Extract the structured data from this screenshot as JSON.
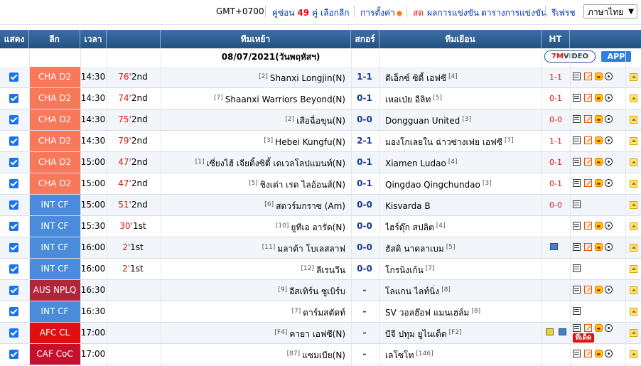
{
  "topbar": {
    "timezone": "GMT+0700",
    "pairs_prefix": "คู่ซ่อน",
    "pairs_count": "49",
    "pairs_suffix": "คู่",
    "select_league": "เลือกลีก",
    "settings": "การตั้งค่า",
    "live": "สด",
    "results": "ผลการแข่งขัน",
    "fixtures": "ตารางการแข่งขัน",
    "refresh": "รีเฟรช",
    "language": "ภาษาไทย"
  },
  "columns": {
    "show": "แสดง",
    "league": "ลีก",
    "time": "เวลา",
    "home": "ทีมเหย้า",
    "score": "สกอร์",
    "away": "ทีมเยือน",
    "ht": "HT"
  },
  "date_label": "08/07/2021(วันพฤหัสฯ)",
  "buttons": {
    "video_7": "7M",
    "video_text": "VIDEO",
    "app": "APP"
  },
  "colors": {
    "cha": "#f8785a",
    "int": "#4a8cdb",
    "aus": "#b0263a",
    "afc": "#e01010",
    "caf": "#c8102e"
  },
  "matches": [
    {
      "league": "CHA D2",
      "color": "#f8785a",
      "time": "14:30",
      "minute": "76'",
      "half": "2nd",
      "home_rank": "[2]",
      "home": "Shanxi Longjin(N)",
      "score": "1-1",
      "away": "ดีเอ็กซ์ ซิตี้ เอฟซี",
      "away_rank": "[4]",
      "ht": "1-1",
      "icons": [
        "note",
        "edit",
        "face",
        "ball"
      ]
    },
    {
      "league": "CHA D2",
      "color": "#f8785a",
      "time": "14:30",
      "minute": "74'",
      "half": "2nd",
      "home_rank": "[7]",
      "home": "Shaanxi Warriors Beyond(N)",
      "score": "0-1",
      "away": "เหอเป่ย อีลิท",
      "away_rank": "[5]",
      "ht": "0-1",
      "icons": [
        "note",
        "edit",
        "face",
        "ball"
      ]
    },
    {
      "league": "CHA D2",
      "color": "#f8785a",
      "time": "14:30",
      "minute": "75'",
      "half": "2nd",
      "home_rank": "[2]",
      "home": "เสือฉื่อขุน(N)",
      "score": "0-0",
      "away": "Dongguan United",
      "away_rank": "[3]",
      "ht": "0-0",
      "icons": [
        "note",
        "edit",
        "face",
        "ball"
      ]
    },
    {
      "league": "CHA D2",
      "color": "#f8785a",
      "time": "14:30",
      "minute": "79'",
      "half": "2nd",
      "home_rank": "[3]",
      "home": "Hebei Kungfu(N)",
      "score": "2-1",
      "away": "มองโกเลยใน ฉ่าวซ่างเฟย เอฟซี",
      "away_rank": "[7]",
      "ht": "1-1",
      "icons": [
        "note",
        "edit",
        "face",
        "ball"
      ]
    },
    {
      "league": "CHA D2",
      "color": "#f8785a",
      "time": "15:00",
      "minute": "47'",
      "half": "2nd",
      "home_rank": "[1]",
      "home": "เซี่ยงไฮ้ เจียติ้งซิตี้ เดเวลโลปแมนท์(N)",
      "score": "0-1",
      "away": "Xiamen Ludao",
      "away_rank": "[4]",
      "ht": "0-1",
      "icons": [
        "note",
        "edit",
        "face",
        "ball"
      ]
    },
    {
      "league": "CHA D2",
      "color": "#f8785a",
      "time": "15:00",
      "minute": "47'",
      "half": "2nd",
      "home_rank": "[5]",
      "home": "ชิงเต่า เรด ไลอ้อนส์(N)",
      "score": "0-1",
      "away": "Qingdao Qingchundao",
      "away_rank": "[3]",
      "ht": "0-1",
      "icons": [
        "note",
        "edit",
        "face",
        "ball"
      ]
    },
    {
      "league": "INT CF",
      "color": "#4a8cdb",
      "time": "15:00",
      "minute": "51'",
      "half": "2nd",
      "home_rank": "[6]",
      "home": "สตวร์มกราซ (Am)",
      "score": "0-0",
      "away": "Kisvarda B",
      "away_rank": "",
      "ht": "0-0",
      "icons": [
        "note"
      ]
    },
    {
      "league": "INT CF",
      "color": "#4a8cdb",
      "time": "15:30",
      "minute": "30'",
      "half": "1st",
      "home_rank": "[10]",
      "home": "ยูทีเอ อารัด(N)",
      "score": "0-0",
      "away": "ไฮร์ดุ๊ก สปลิต",
      "away_rank": "[4]",
      "ht": "",
      "icons": [
        "note",
        "edit",
        "face",
        "ball"
      ]
    },
    {
      "league": "INT CF",
      "color": "#4a8cdb",
      "time": "16:00",
      "minute": "2'",
      "half": "1st",
      "home_rank": "[11]",
      "home": "มลาด้า โบเลสลาฟ",
      "score": "0-0",
      "away": "ฮัสดิ นาดลาเบม",
      "away_rank": "[5]",
      "ht": "",
      "icons": [
        "note",
        "edit",
        "face",
        "ball"
      ],
      "tv": true
    },
    {
      "league": "INT CF",
      "color": "#4a8cdb",
      "time": "16:00",
      "minute": "2'",
      "half": "1st",
      "home_rank": "[12]",
      "home": "ลีเรนวีน",
      "score": "0-0",
      "away": "โกรนิงเก้น",
      "away_rank": "[7]",
      "ht": "",
      "icons": [
        "note"
      ]
    },
    {
      "league": "AUS NPLQ",
      "color": "#b0263a",
      "time": "16:30",
      "minute": "",
      "half": "",
      "home_rank": "[9]",
      "home": "อีสเทิร์น ซูเบิร์บ",
      "score": "-",
      "away": "โลแกน ไลท์นิ่ง",
      "away_rank": "[8]",
      "ht": "",
      "icons": [
        "note",
        "edit",
        "face",
        "ball"
      ]
    },
    {
      "league": "INT CF",
      "color": "#4a8cdb",
      "time": "16:30",
      "minute": "",
      "half": "",
      "home_rank": "[7]",
      "home": "ดาร์มสตัดท์",
      "score": "-",
      "away": "SV วอลฮ๊อฟ แมนเฮล์ม",
      "away_rank": "[8]",
      "ht": "",
      "icons": [
        "note"
      ]
    },
    {
      "league": "AFC CL",
      "color": "#e01010",
      "time": "17:00",
      "minute": "",
      "half": "",
      "home_rank": "[F4]",
      "home": "คายา เอฟซี(N)",
      "score": "-",
      "away": "บีจี ปทุม ยูไนเต็ด",
      "away_rank": "[F2]",
      "ht": "",
      "icons": [
        "note",
        "edit",
        "face",
        "ball"
      ],
      "tv2": true,
      "badge": "ทีเด็ด"
    },
    {
      "league": "CAF CoC",
      "color": "#c8102e",
      "time": "17:00",
      "minute": "",
      "half": "",
      "home_rank": "[87]",
      "home": "แซมเบีย(N)",
      "score": "-",
      "away": "เลโซโท",
      "away_rank": "[146]",
      "ht": "",
      "icons": [
        "note",
        "edit",
        "face",
        "ball"
      ]
    }
  ]
}
